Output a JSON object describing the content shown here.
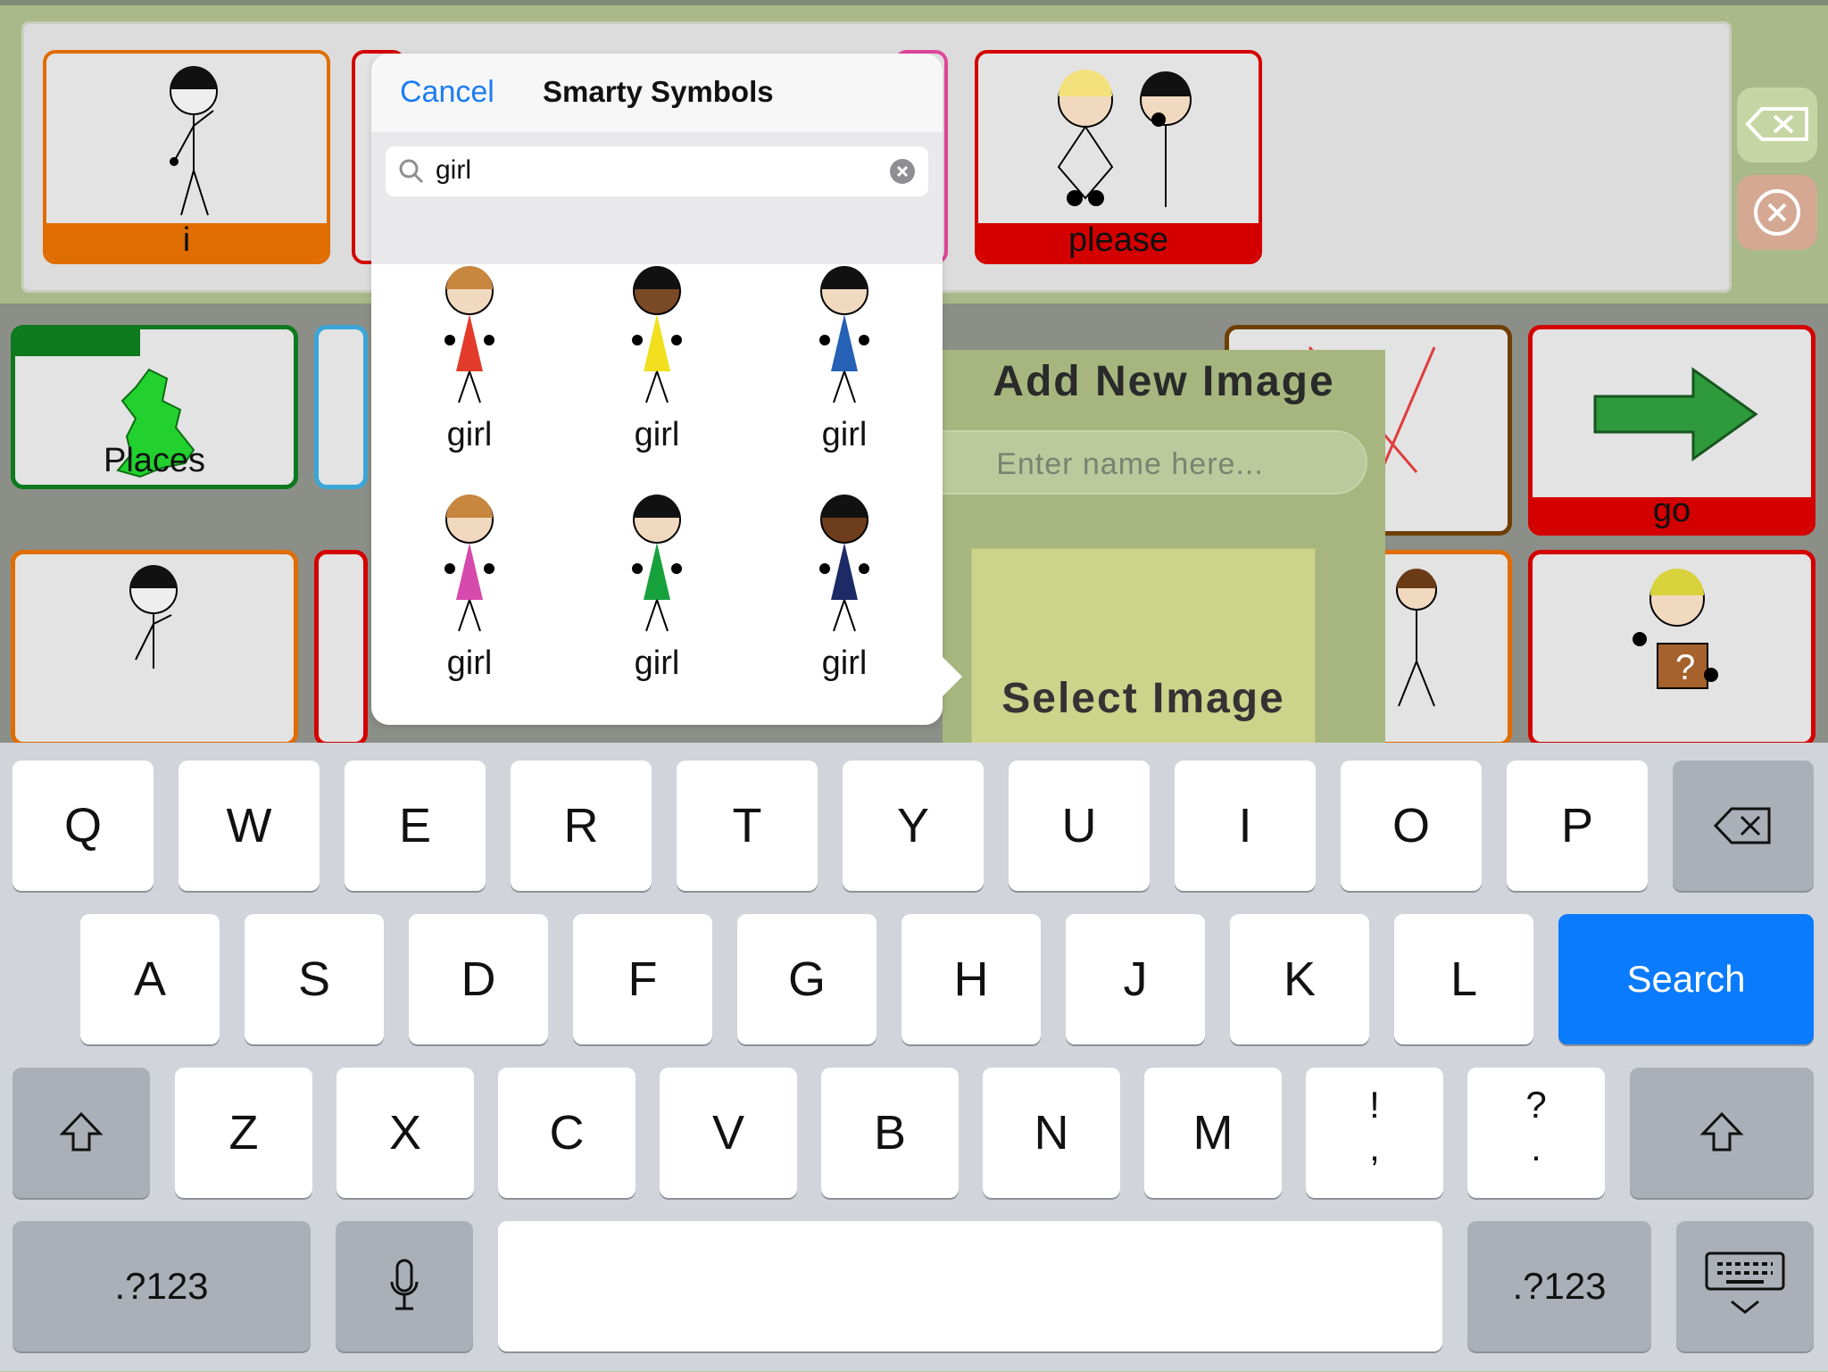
{
  "sentence_strip": {
    "tiles": [
      {
        "label": "i",
        "color": "#e06d00"
      },
      {
        "label": "please",
        "color": "#d40000"
      }
    ]
  },
  "grid": {
    "tiles": [
      {
        "label": "Places",
        "color": "#0c7a1d"
      },
      {
        "label": "go",
        "color": "#d40000"
      }
    ]
  },
  "popover": {
    "cancel": "Cancel",
    "title": "Smarty Symbols",
    "search_value": "girl",
    "results": [
      "girl",
      "girl",
      "girl",
      "girl",
      "girl",
      "girl"
    ],
    "result_colors": [
      "#e23b2b",
      "#f2df1e",
      "#2561b5",
      "#d74aad",
      "#17a13d",
      "#1c2a66"
    ]
  },
  "add_image": {
    "title": "Add New Image",
    "placeholder": "Enter name here...",
    "select_label": "Select Image"
  },
  "keyboard": {
    "row1": [
      "Q",
      "W",
      "E",
      "R",
      "T",
      "Y",
      "U",
      "I",
      "O",
      "P"
    ],
    "row2": [
      "A",
      "S",
      "D",
      "F",
      "G",
      "H",
      "J",
      "K",
      "L"
    ],
    "search_key": "Search",
    "row3": [
      "Z",
      "X",
      "C",
      "V",
      "B",
      "N",
      "M"
    ],
    "punct1": [
      "!",
      ","
    ],
    "punct2": [
      "?",
      "."
    ],
    "numbers_key": ".?123"
  },
  "colors": {
    "accent": "#0a7bfd",
    "app_bg": "#a9b989"
  }
}
